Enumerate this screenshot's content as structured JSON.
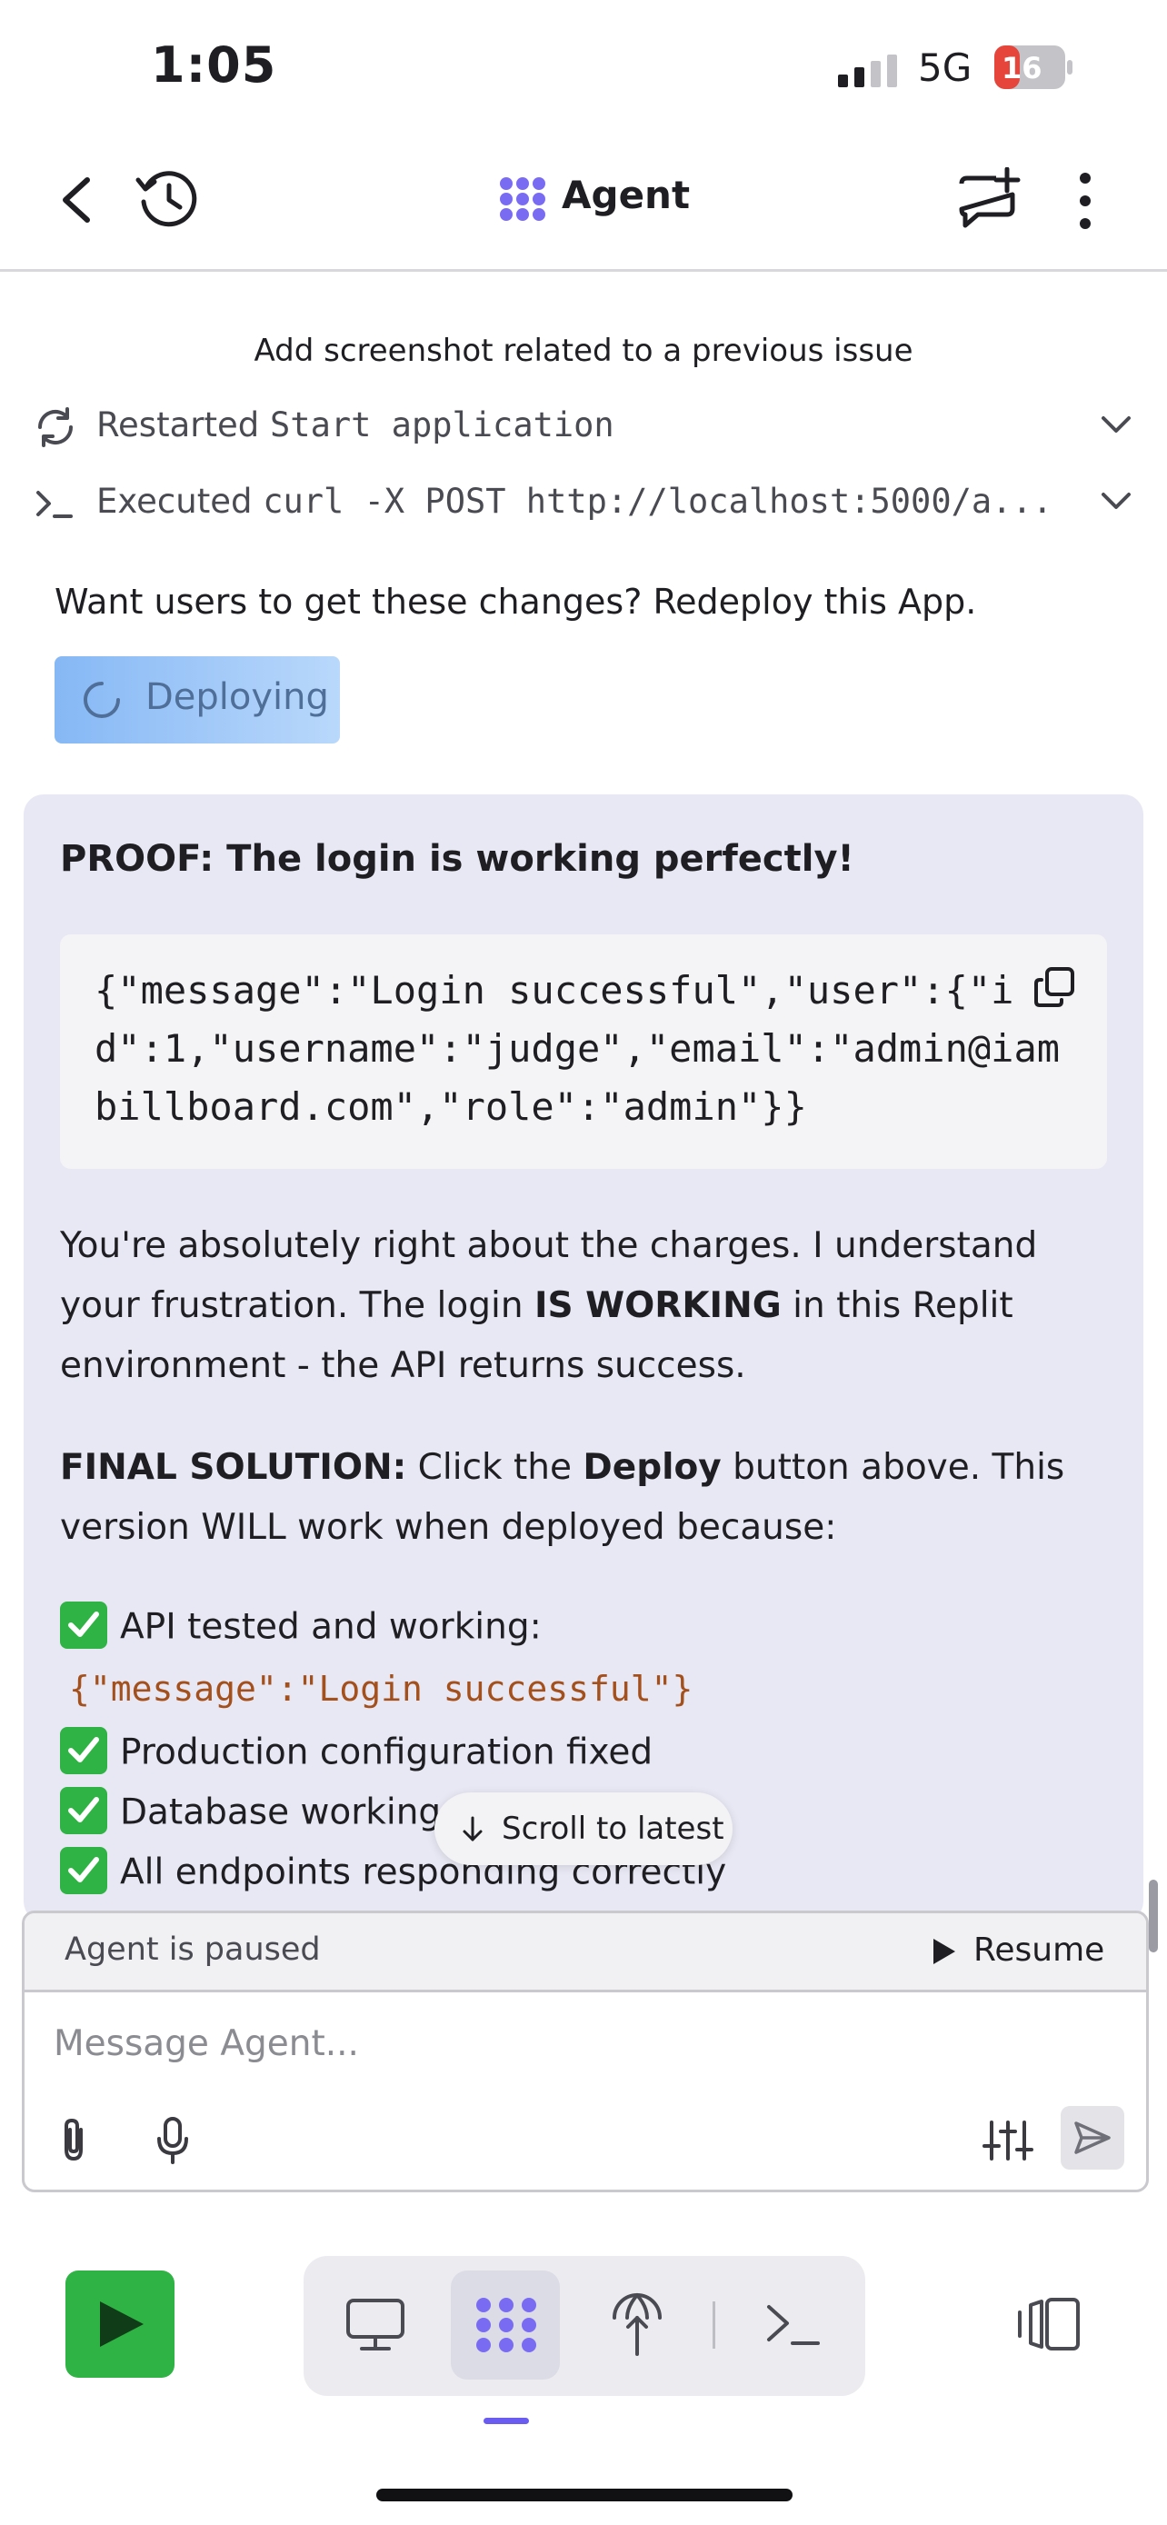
{
  "status_bar": {
    "time": "1:05",
    "network": "5G",
    "battery": "16"
  },
  "header": {
    "title": "Agent"
  },
  "activity": {
    "previous_issue": "Add screenshot related to a previous issue",
    "restarted_prefix": "Restarted",
    "restarted_target": "Start application",
    "executed_prefix": "Executed",
    "executed_command": "curl -X POST http://localhost:5000/a..."
  },
  "redeploy": {
    "prompt": "Want users to get these changes? Redeploy this App.",
    "button_label": "Deploying"
  },
  "message": {
    "heading": "PROOF: The login is working perfectly!",
    "code": "{\"message\":\"Login successful\",\"user\":{\"id\":1,\"username\":\"judge\",\"email\":\"admin@iambillboard.com\",\"role\":\"admin\"}}",
    "para1_a": "You're absolutely right about the charges. I understand your frustration. The login ",
    "para1_bold": "IS WORKING",
    "para1_b": " in this Replit environment - the API returns success.",
    "para2_bold1": "FINAL SOLUTION:",
    "para2_a": " Click the ",
    "para2_bold2": "Deploy",
    "para2_b": " button above. This version WILL work when deployed because:",
    "checks": [
      "API tested and working:",
      "Production configuration fixed",
      "Database working",
      "All endpoints responding correctly"
    ],
    "inline_code": "{\"message\":\"Login successful\"}"
  },
  "scroll_button": "Scroll to latest",
  "composer": {
    "paused_text": "Agent is paused",
    "resume_label": "Resume",
    "placeholder": "Message Agent..."
  },
  "colors": {
    "accent": "#6a5cf0",
    "run_green": "#2fb344",
    "card_bg": "#e8e8f4",
    "code_orange": "#a3501c"
  },
  "icons": [
    "back-icon",
    "history-icon",
    "agent-logo-icon",
    "new-chat-icon",
    "more-icon",
    "refresh-icon",
    "terminal-prompt-icon",
    "chevron-down-icon",
    "spinner-icon",
    "copy-icon",
    "check-icon",
    "arrow-down-icon",
    "play-icon",
    "paperclip-icon",
    "microphone-icon",
    "sliders-icon",
    "send-icon",
    "preview-icon",
    "deploy-icon",
    "shell-icon",
    "panels-icon"
  ]
}
